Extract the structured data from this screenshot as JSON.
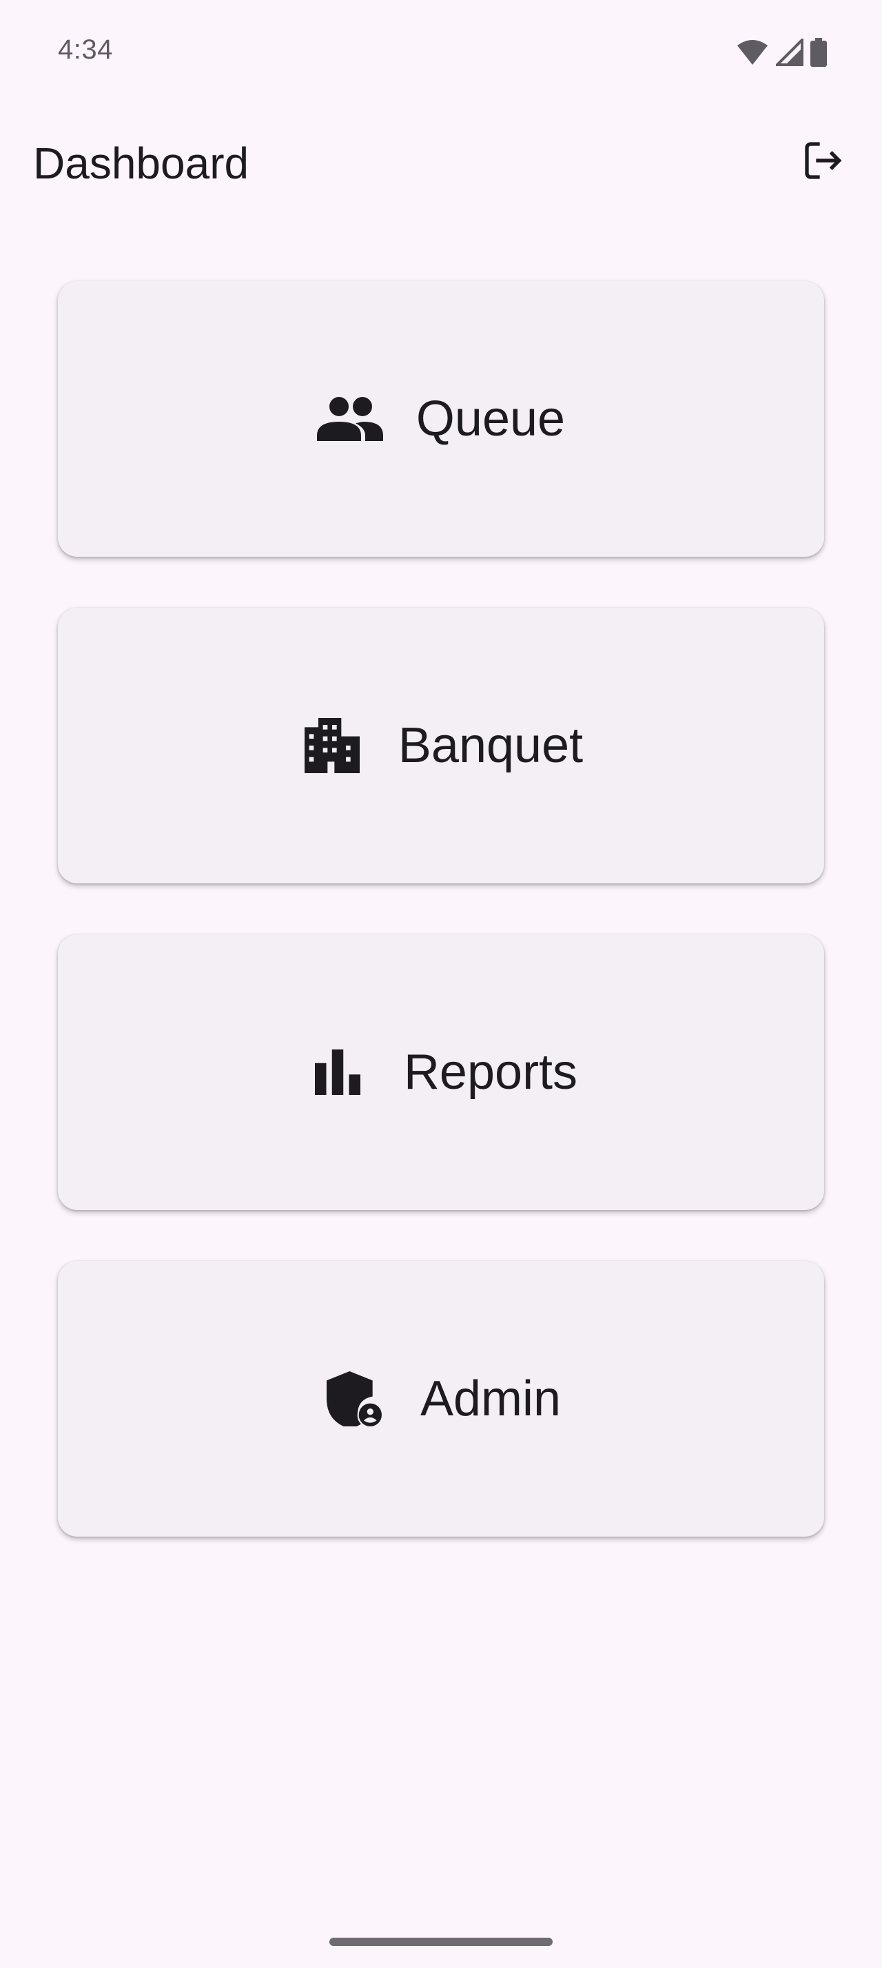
{
  "status_bar": {
    "time": "4:34",
    "icons": [
      "wifi-icon",
      "cellular-signal-icon",
      "battery-icon"
    ]
  },
  "app_bar": {
    "title": "Dashboard",
    "actions": [
      {
        "icon": "logout-icon"
      }
    ]
  },
  "cards": [
    {
      "label": "Queue",
      "icon": "people-icon"
    },
    {
      "label": "Banquet",
      "icon": "building-icon"
    },
    {
      "label": "Reports",
      "icon": "bar-chart-icon"
    },
    {
      "label": "Admin",
      "icon": "admin-shield-icon"
    }
  ],
  "colors": {
    "background": "#fcf5fb",
    "card_background": "#f4eff5",
    "text": "#1d1b20",
    "status_text": "#5f5b63"
  }
}
